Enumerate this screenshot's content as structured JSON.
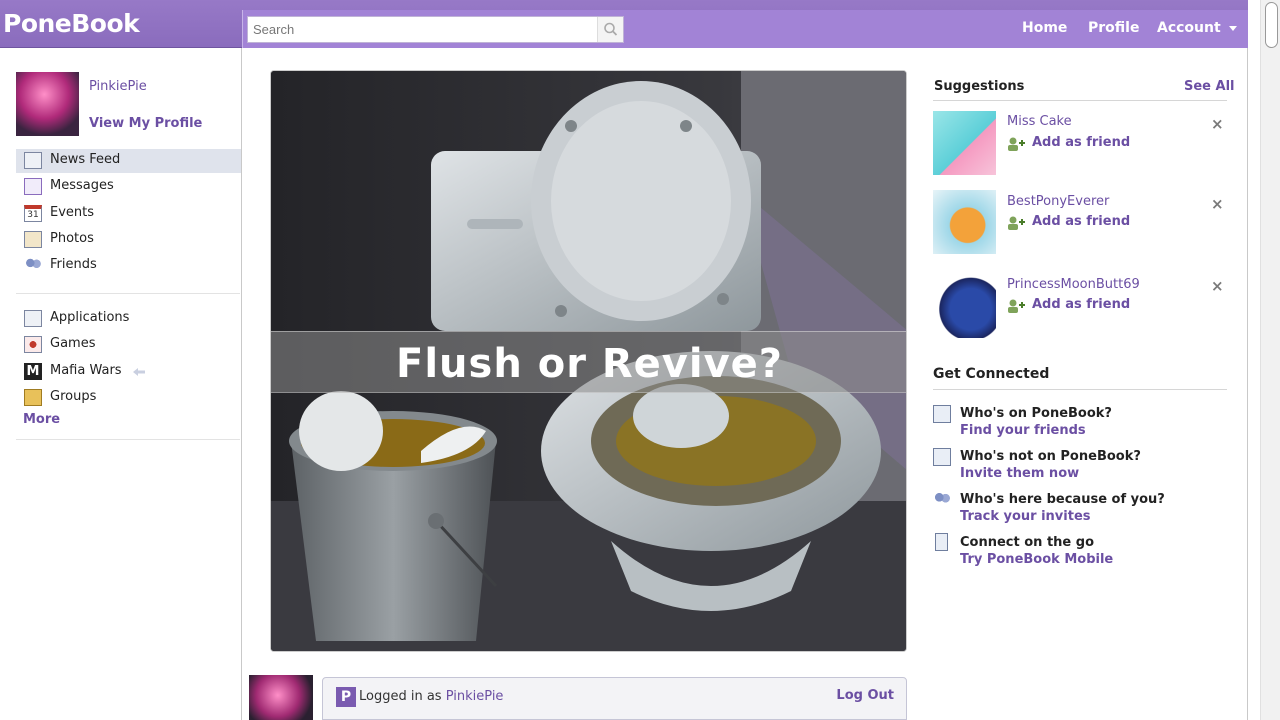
{
  "header": {
    "logo": "PoneBook",
    "search_placeholder": "Search",
    "nav": {
      "home": "Home",
      "profile": "Profile",
      "account": "Account"
    }
  },
  "sidebar": {
    "profile_name": "PinkiePie",
    "view_profile": "View My Profile",
    "items": [
      {
        "label": "News Feed",
        "icon": "news-feed-icon",
        "active": true
      },
      {
        "label": "Messages",
        "icon": "messages-icon"
      },
      {
        "label": "Events",
        "icon": "calendar-icon",
        "icon_text": "31"
      },
      {
        "label": "Photos",
        "icon": "photos-icon"
      },
      {
        "label": "Friends",
        "icon": "friends-icon"
      }
    ],
    "apps": [
      {
        "label": "Applications",
        "icon": "applications-icon"
      },
      {
        "label": "Games",
        "icon": "games-icon"
      },
      {
        "label": "Mafia Wars",
        "icon": "mafia-wars-icon",
        "icon_text": "M"
      },
      {
        "label": "Groups",
        "icon": "groups-icon"
      }
    ],
    "more": "More"
  },
  "main": {
    "hero_caption": "Flush or Revive?",
    "post_box": {
      "logo": "P",
      "logged_in_prefix": "Logged in as",
      "user": "PinkiePie",
      "logout": "Log Out"
    }
  },
  "suggestions": {
    "title": "Suggestions",
    "see_all": "See All",
    "items": [
      {
        "name": "Miss Cake",
        "action": "Add as friend"
      },
      {
        "name": "BestPonyEverer",
        "action": "Add as friend"
      },
      {
        "name": "PrincessMoonButt69",
        "action": "Add as friend"
      }
    ]
  },
  "get_connected": {
    "title": "Get Connected",
    "items": [
      {
        "title": "Who's on PoneBook?",
        "link": "Find your friends"
      },
      {
        "title": "Who's not on PoneBook?",
        "link": "Invite them now"
      },
      {
        "title": "Who's here because of you?",
        "link": "Track your invites"
      },
      {
        "title": "Connect on the go",
        "link": "Try PoneBook Mobile"
      }
    ]
  },
  "colors": {
    "accent": "#9779c7",
    "link": "#6b4fa3"
  }
}
